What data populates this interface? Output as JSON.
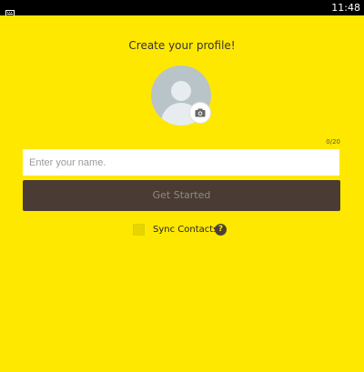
{
  "status_bar": {
    "time": "11:48",
    "left_icon": "keyboard-icon"
  },
  "profile": {
    "title": "Create your profile!",
    "avatar_icon": "default-avatar-icon",
    "camera_icon": "camera-icon",
    "name_counter": "0/20",
    "name_input": {
      "value": "",
      "placeholder": "Enter your name."
    },
    "start_button_label": "Get Started",
    "sync_contacts_label": "Sync Contacts",
    "sync_contacts_checked": false,
    "help_icon_glyph": "?"
  },
  "colors": {
    "background": "#ffe800",
    "button": "#4a3c34",
    "button_text": "#8c8a84",
    "status_bar": "#000000"
  }
}
